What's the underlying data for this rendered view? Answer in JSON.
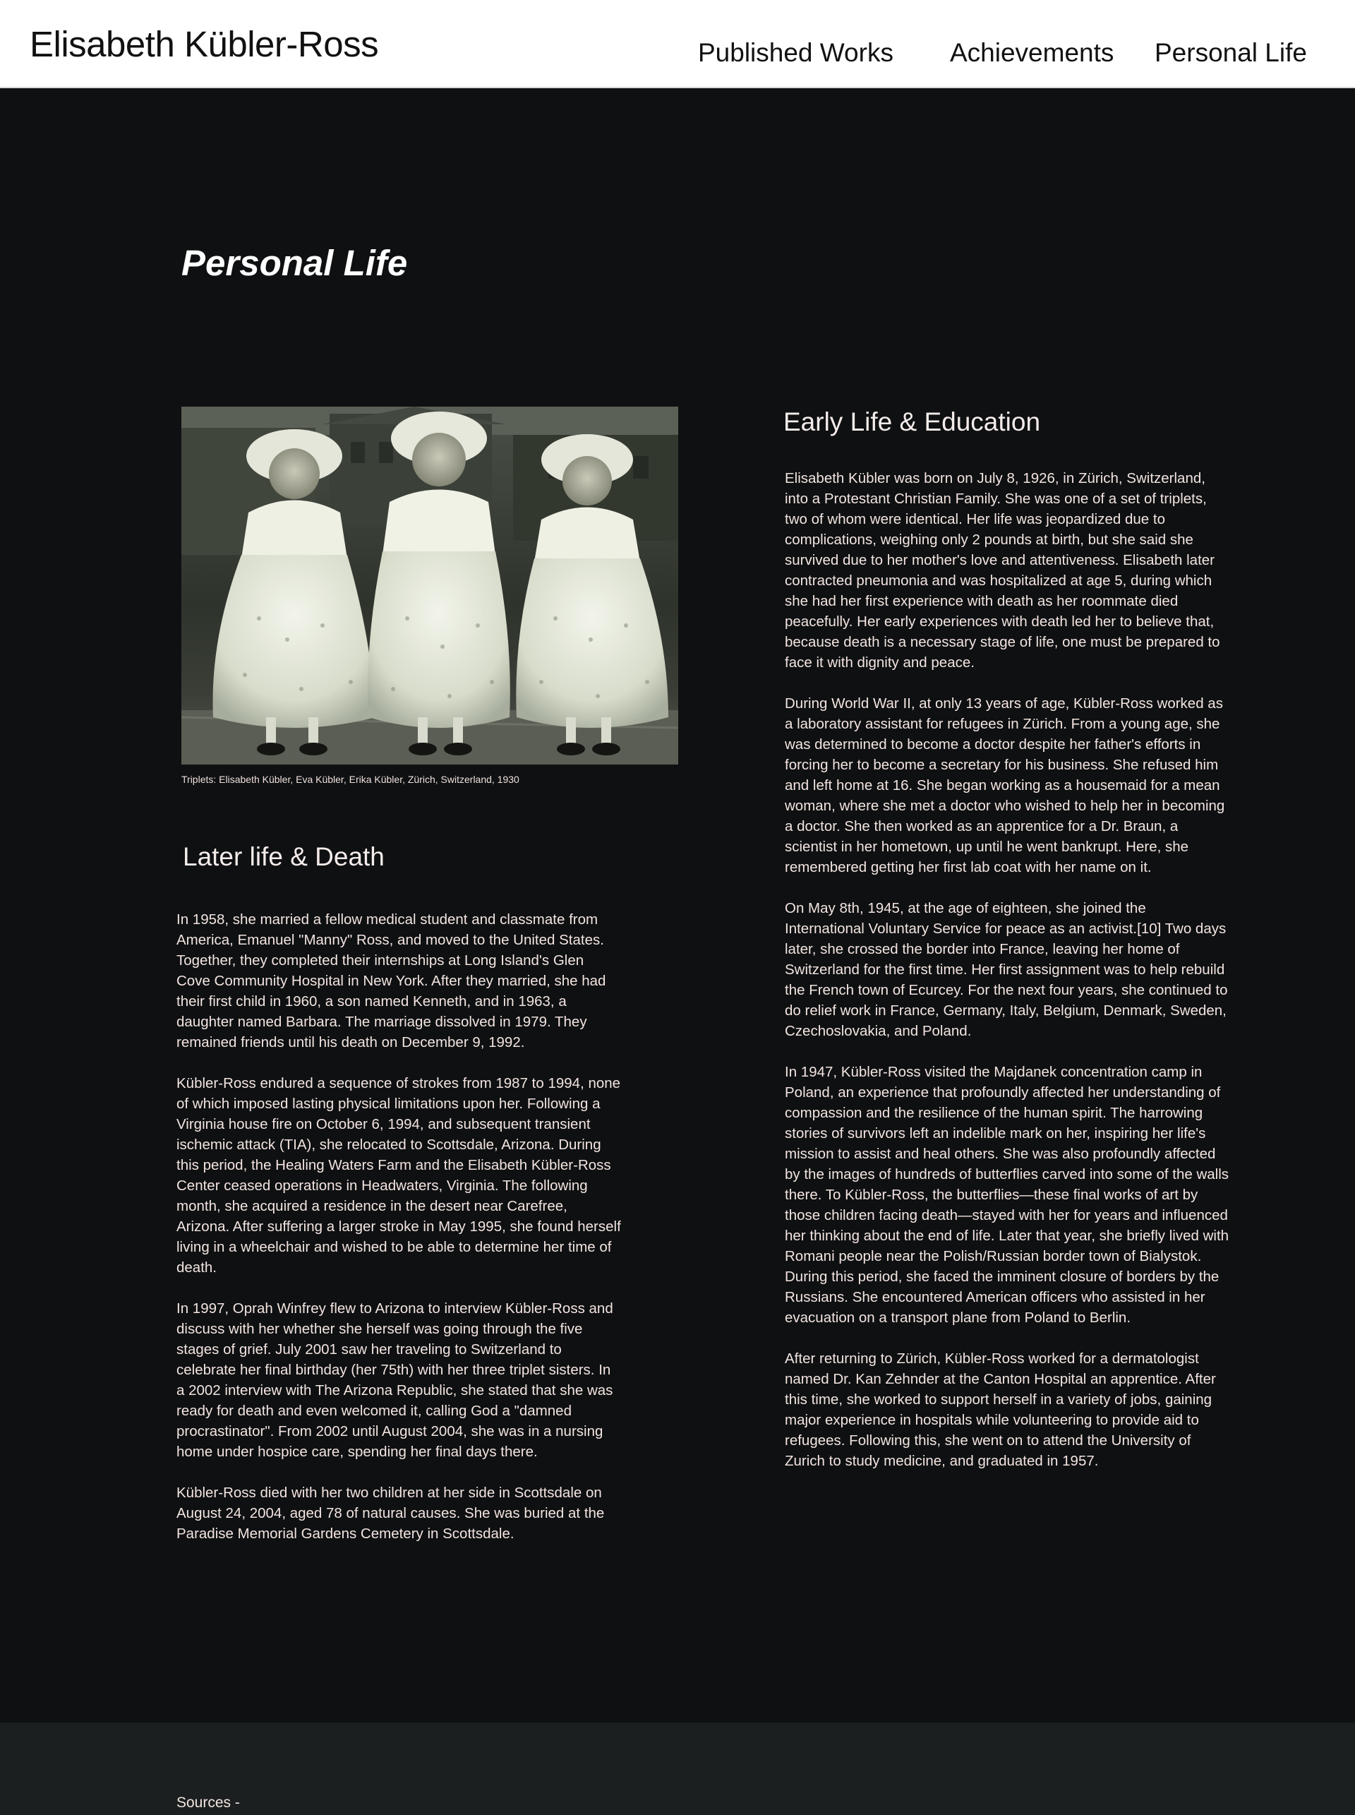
{
  "header": {
    "site_title": "Elisabeth Kübler-Ross",
    "nav": {
      "published_works": "Published Works",
      "achievements": "Achievements",
      "personal_life": "Personal Life"
    }
  },
  "main": {
    "page_title": "Personal Life",
    "photo": {
      "caption": "Triplets: Elisabeth Kübler, Eva Kübler, Erika Kübler, Zürich, Switzerland, 1930"
    },
    "later_life": {
      "heading": "Later life & Death",
      "paragraphs": [
        "In 1958, she married a fellow medical student and classmate from America, Emanuel \"Manny\" Ross, and moved to the United States. Together, they completed their internships at Long Island's Glen Cove Community Hospital in New York. After they married, she had their first child in 1960, a son named Kenneth, and in 1963, a daughter named Barbara. The marriage dissolved in 1979. They remained friends until his death on December 9, 1992.",
        "Kübler-Ross endured a sequence of strokes from 1987 to 1994, none of which imposed lasting physical limitations upon her. Following a Virginia house fire on October 6, 1994, and subsequent transient ischemic attack (TIA), she relocated to Scottsdale, Arizona. During this period, the Healing Waters Farm and the Elisabeth Kübler-Ross Center ceased operations in Headwaters, Virginia. The following month, she acquired a residence in the desert near Carefree, Arizona. After suffering a larger stroke in May 1995, she found herself living in a wheelchair and wished to be able to determine her time of death.",
        "In 1997, Oprah Winfrey flew to Arizona to interview Kübler-Ross and discuss with her whether she herself was going through the five stages of grief. July 2001 saw her traveling to Switzerland to celebrate her final birthday (her 75th) with her three triplet sisters. In a 2002 interview with The Arizona Republic, she stated that she was ready for death and even welcomed it, calling God a \"damned procrastinator\". From 2002 until August 2004, she was in a nursing home under hospice care, spending her final days there.",
        "Kübler-Ross died with her two children at her side in Scottsdale on August 24, 2004, aged 78 of natural causes. She was buried at the Paradise Memorial Gardens Cemetery in Scottsdale."
      ]
    },
    "early_life": {
      "heading": "Early Life & Education",
      "paragraphs": [
        "Elisabeth Kübler was born on July 8, 1926, in Zürich, Switzerland, into a Protestant Christian Family. She was one of a set of triplets, two of whom were identical. Her life was jeopardized due to complications, weighing only 2 pounds at birth, but she said she survived due to her mother's love and attentiveness. Elisabeth later contracted pneumonia and was hospitalized at age 5, during which she had her first experience with death as her roommate died peacefully. Her early experiences with death led her to believe that, because death is a necessary stage of life, one must be prepared to face it with dignity and peace.",
        "During World War II, at only 13 years of age, Kübler-Ross worked as a laboratory assistant for refugees in Zürich. From a young age, she was determined to become a doctor despite her father's efforts in forcing her to become a secretary for his business. She refused him and left home at 16. She began working as a housemaid for a mean woman, where she met a doctor who wished to help her in becoming a doctor. She then worked as an apprentice for a Dr. Braun, a scientist in her hometown, up until he went bankrupt. Here, she remembered getting her first lab coat with her name on it.",
        "On May 8th, 1945, at the age of eighteen, she joined the International Voluntary Service for peace as an activist.[10] Two days later, she crossed the border into France, leaving her home of Switzerland for the first time. Her first assignment was to help rebuild the French town of Ecurcey. For the next four years, she continued to do relief work in France, Germany, Italy, Belgium, Denmark, Sweden, Czechoslovakia, and Poland.",
        "In 1947, Kübler-Ross visited the Majdanek concentration camp in Poland, an experience that profoundly affected her understanding of compassion and the resilience of the human spirit. The harrowing stories of survivors left an indelible mark on her, inspiring her life's mission to assist and heal others. She was also profoundly affected by the images of hundreds of butterflies carved into some of the walls there. To Kübler-Ross, the butterflies—these final works of art by those children facing death—stayed with her for years and influenced her thinking about the end of life. Later that year, she briefly lived with Romani people near the Polish/Russian border town of Bialystok. During this period, she faced the imminent closure of borders by the Russians. She encountered American officers who assisted in her evacuation on a transport plane from Poland to Berlin.",
        "After returning to Zürich, Kübler-Ross worked for a dermatologist named Dr. Kan Zehnder at the Canton Hospital an apprentice. After this time, she worked to support herself in a variety of jobs, gaining major experience in hospitals while volunteering to provide aid to refugees. Following this, she went on to attend the University of Zurich to study medicine, and graduated in 1957."
      ]
    }
  },
  "footer": {
    "sources_label": "Sources -"
  }
}
